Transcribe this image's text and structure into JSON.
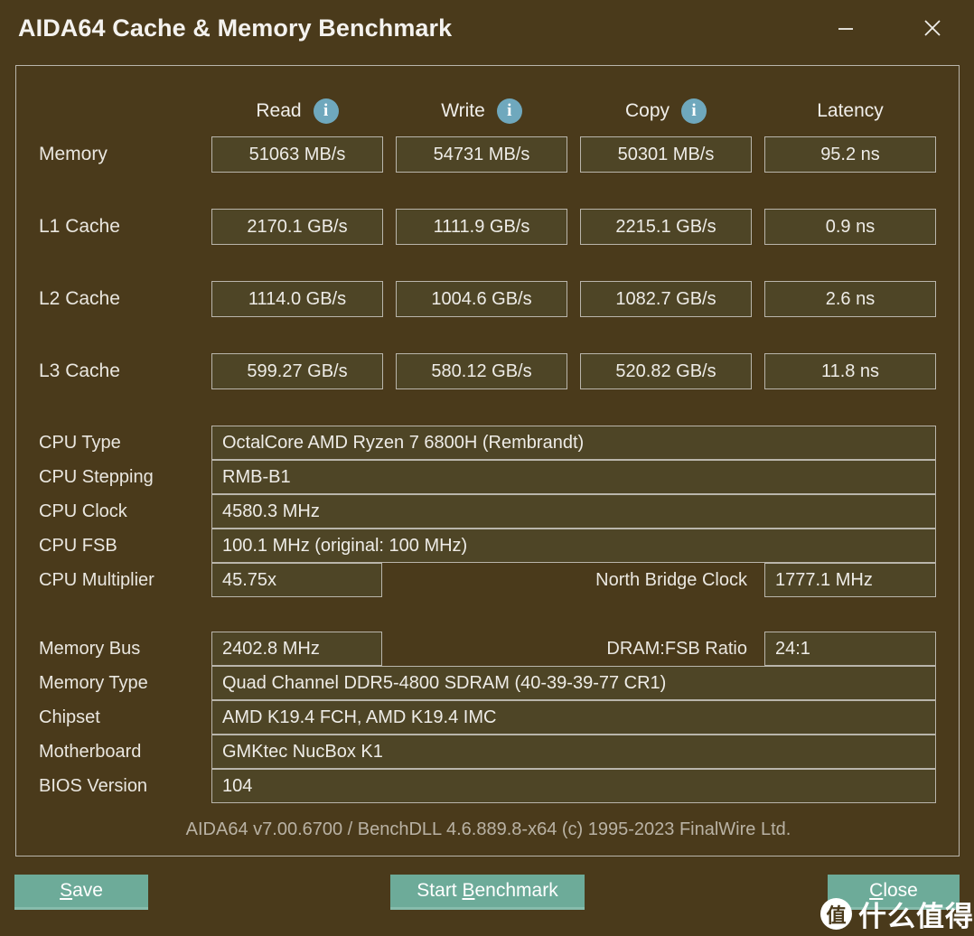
{
  "window": {
    "title": "AIDA64 Cache & Memory Benchmark",
    "minimize_label": "Minimize",
    "close_label": "Close",
    "minimize_icon": "minimize-icon",
    "close_icon": "close-icon"
  },
  "benchmark": {
    "columns": [
      {
        "label": "Read",
        "has_info_icon": true,
        "info_icon": "info-icon"
      },
      {
        "label": "Write",
        "has_info_icon": true,
        "info_icon": "info-icon"
      },
      {
        "label": "Copy",
        "has_info_icon": true,
        "info_icon": "info-icon"
      },
      {
        "label": "Latency",
        "has_info_icon": false
      }
    ],
    "rows": [
      {
        "label": "Memory",
        "read": "51063 MB/s",
        "write": "54731 MB/s",
        "copy": "50301 MB/s",
        "latency": "95.2 ns"
      },
      {
        "label": "L1 Cache",
        "read": "2170.1 GB/s",
        "write": "1111.9 GB/s",
        "copy": "2215.1 GB/s",
        "latency": "0.9 ns"
      },
      {
        "label": "L2 Cache",
        "read": "1114.0 GB/s",
        "write": "1004.6 GB/s",
        "copy": "1082.7 GB/s",
        "latency": "2.6 ns"
      },
      {
        "label": "L3 Cache",
        "read": "599.27 GB/s",
        "write": "580.12 GB/s",
        "copy": "520.82 GB/s",
        "latency": "11.8 ns"
      }
    ]
  },
  "cpu_info": {
    "cpu_type_label": "CPU Type",
    "cpu_type_value": "OctalCore AMD Ryzen 7 6800H  (Rembrandt)",
    "cpu_stepping_label": "CPU Stepping",
    "cpu_stepping_value": "RMB-B1",
    "cpu_clock_label": "CPU Clock",
    "cpu_clock_value": "4580.3 MHz",
    "cpu_fsb_label": "CPU FSB",
    "cpu_fsb_value": "100.1 MHz  (original: 100 MHz)",
    "cpu_multiplier_label": "CPU Multiplier",
    "cpu_multiplier_value": "45.75x",
    "north_bridge_clock_label": "North Bridge Clock",
    "north_bridge_clock_value": "1777.1 MHz"
  },
  "memory_info": {
    "memory_bus_label": "Memory Bus",
    "memory_bus_value": "2402.8 MHz",
    "dram_fsb_ratio_label": "DRAM:FSB Ratio",
    "dram_fsb_ratio_value": "24:1",
    "memory_type_label": "Memory Type",
    "memory_type_value": "Quad Channel DDR5-4800 SDRAM  (40-39-39-77 CR1)",
    "chipset_label": "Chipset",
    "chipset_value": "AMD K19.4 FCH, AMD K19.4 IMC",
    "motherboard_label": "Motherboard",
    "motherboard_value": "GMKtec NucBox K1",
    "bios_version_label": "BIOS Version",
    "bios_version_value": "104"
  },
  "credit": "AIDA64 v7.00.6700 / BenchDLL 4.6.889.8-x64  (c) 1995-2023 FinalWire Ltd.",
  "buttons": {
    "save": {
      "prefix": "",
      "accel": "S",
      "suffix": "ave"
    },
    "start_benchmark": {
      "prefix": "Start ",
      "accel": "B",
      "suffix": "enchmark"
    },
    "close": {
      "prefix": "",
      "accel": "C",
      "suffix": "lose"
    }
  },
  "watermark": {
    "logo_char": "值",
    "text": "什么值得买"
  },
  "colors": {
    "background": "#4a3a1b",
    "field_fill": "#4e4526",
    "field_border": "#b9b5ab",
    "button_teal": "#6dab99",
    "button_teal_edge": "#87bcac",
    "info_icon_blue": "#6fa8bd",
    "text_primary": "#eeece7",
    "text_muted": "#b9b2a4"
  }
}
